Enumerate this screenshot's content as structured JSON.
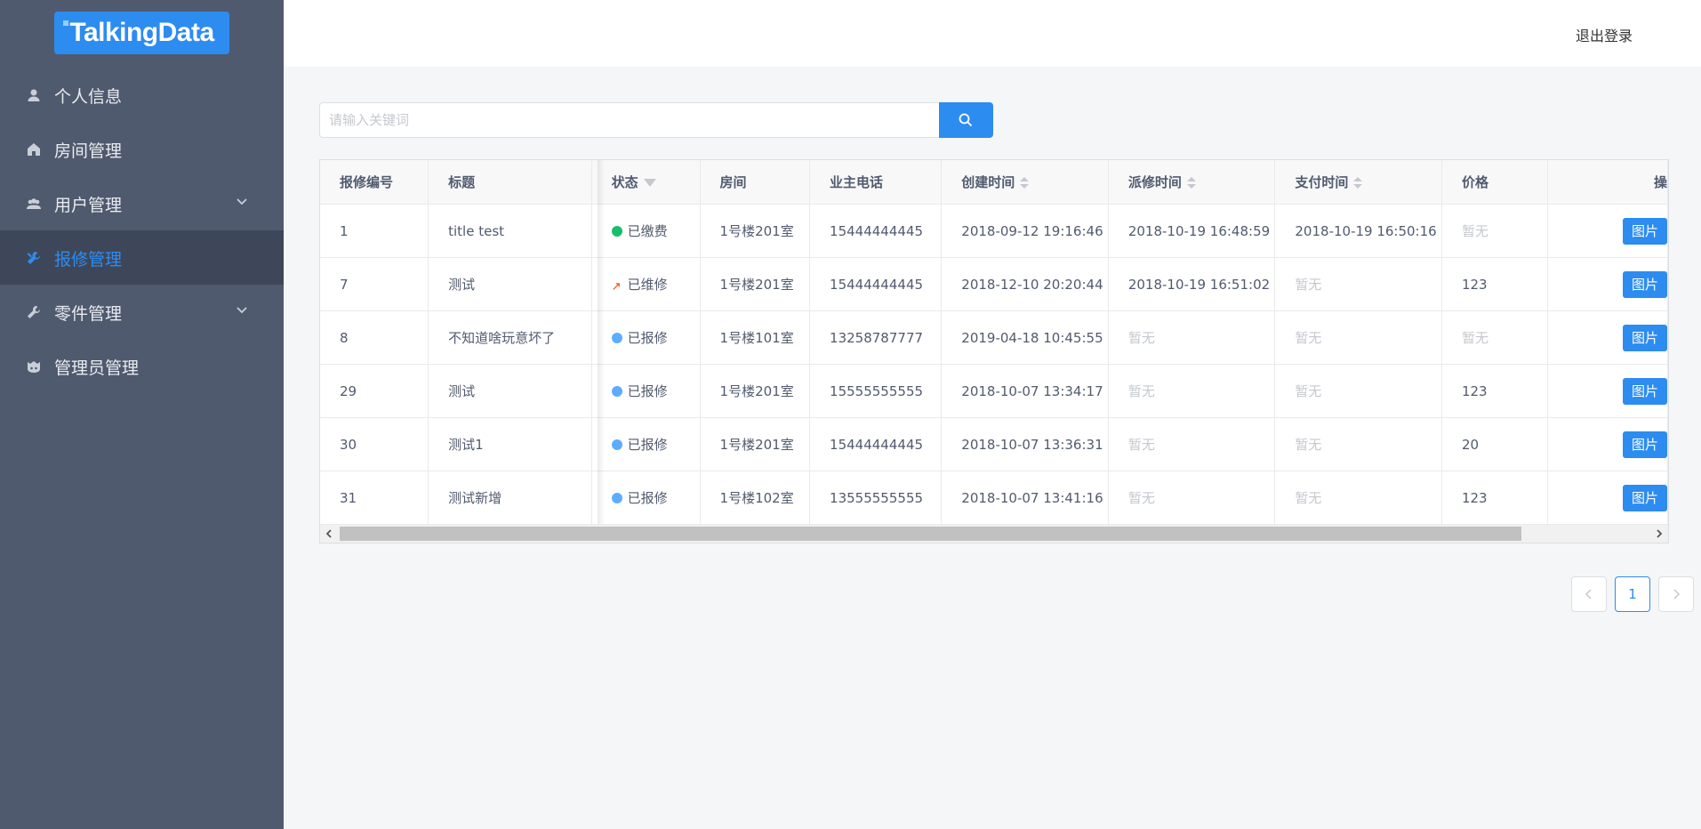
{
  "sidebar": {
    "logo": "TalkingData",
    "items": [
      {
        "label": "个人信息",
        "icon": "user-icon"
      },
      {
        "label": "房间管理",
        "icon": "home-icon"
      },
      {
        "label": "用户管理",
        "icon": "people-icon",
        "has_submenu": true
      },
      {
        "label": "报修管理",
        "icon": "tools-icon",
        "active": true
      },
      {
        "label": "零件管理",
        "icon": "wrench-icon",
        "has_submenu": true
      },
      {
        "label": "管理员管理",
        "icon": "admin-icon"
      }
    ]
  },
  "header": {
    "logout": "退出登录"
  },
  "search": {
    "placeholder": "请输入关键词",
    "value": ""
  },
  "table": {
    "headers": [
      "报修编号",
      "标题",
      "状态",
      "房间",
      "业主电话",
      "创建时间",
      "派修时间",
      "支付时间",
      "价格",
      "操"
    ],
    "rows": [
      {
        "id": "1",
        "title": "title test",
        "status": "已缴费",
        "status_type": "success",
        "room": "1号楼201室",
        "phone": "15444444445",
        "created": "2018-09-12 19:16:46",
        "dispatched": "2018-10-19 16:48:59",
        "paid": "2018-10-19 16:50:16",
        "price": "暂无",
        "action": "图片"
      },
      {
        "id": "7",
        "title": "测试",
        "status": "已维修",
        "status_type": "repair",
        "room": "1号楼201室",
        "phone": "15444444445",
        "created": "2018-12-10 20:20:44",
        "dispatched": "2018-10-19 16:51:02",
        "paid": "暂无",
        "price": "123",
        "action": "图片"
      },
      {
        "id": "8",
        "title": "不知道啥玩意坏了",
        "status": "已报修",
        "status_type": "info",
        "room": "1号楼101室",
        "phone": "13258787777",
        "created": "2019-04-18 10:45:55",
        "dispatched": "暂无",
        "paid": "暂无",
        "price": "暂无",
        "action": "图片"
      },
      {
        "id": "29",
        "title": "测试",
        "status": "已报修",
        "status_type": "info",
        "room": "1号楼201室",
        "phone": "15555555555",
        "created": "2018-10-07 13:34:17",
        "dispatched": "暂无",
        "paid": "暂无",
        "price": "123",
        "action": "图片"
      },
      {
        "id": "30",
        "title": "测试1",
        "status": "已报修",
        "status_type": "info",
        "room": "1号楼201室",
        "phone": "15444444445",
        "created": "2018-10-07 13:36:31",
        "dispatched": "暂无",
        "paid": "暂无",
        "price": "20",
        "action": "图片"
      },
      {
        "id": "31",
        "title": "测试新增",
        "status": "已报修",
        "status_type": "info",
        "room": "1号楼102室",
        "phone": "13555555555",
        "created": "2018-10-07 13:41:16",
        "dispatched": "暂无",
        "paid": "暂无",
        "price": "123",
        "action": "图片"
      }
    ],
    "empty_value": "暂无"
  },
  "pagination": {
    "current": "1"
  },
  "colors": {
    "primary": "#2d8cf0",
    "sidebar": "#505a6e",
    "success": "#19be6b",
    "info": "#5cadff",
    "repair": "#ed4014"
  }
}
